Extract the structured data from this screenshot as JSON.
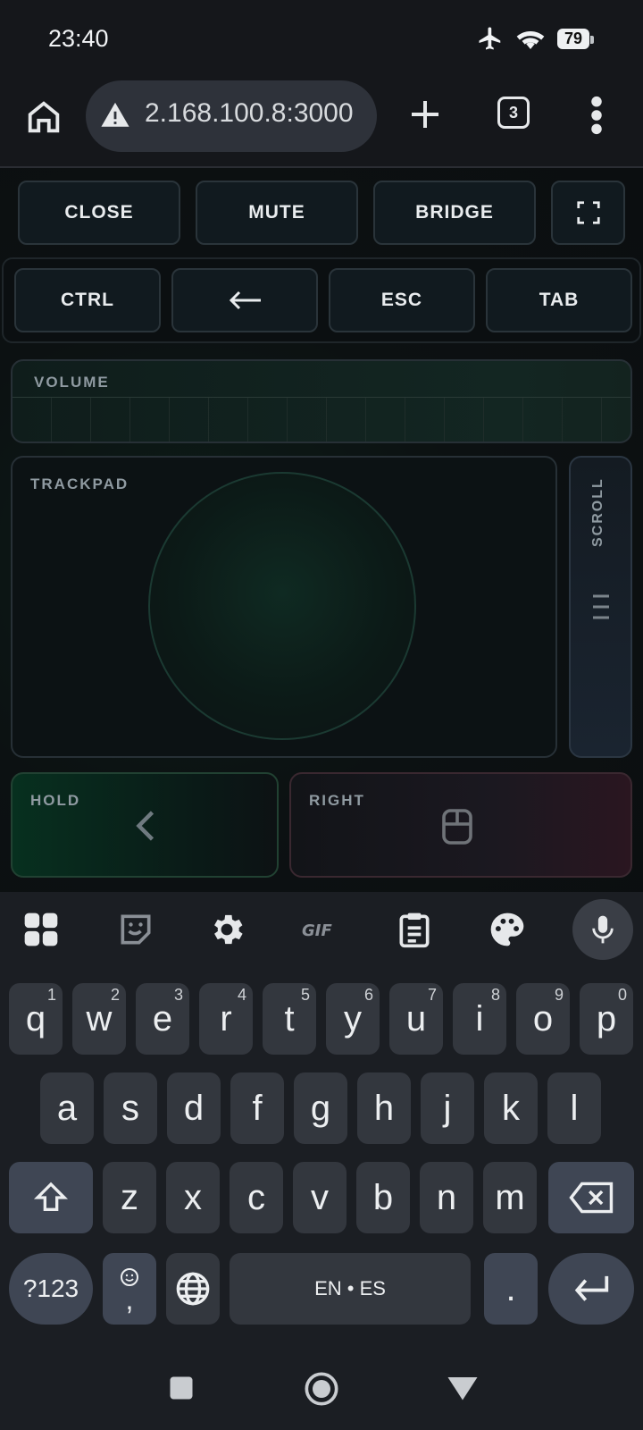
{
  "status": {
    "time": "23:40",
    "battery": "79"
  },
  "browser": {
    "url": "2.168.100.8:3000",
    "tabs_count": "3"
  },
  "controls_row1": [
    "CLOSE",
    "MUTE",
    "BRIDGE"
  ],
  "controls_row2": {
    "ctrl": "CTRL",
    "esc": "ESC",
    "tab": "TAB"
  },
  "volume": {
    "label": "VOLUME"
  },
  "trackpad": {
    "label": "TRACKPAD"
  },
  "scroll": {
    "label": "SCROLL"
  },
  "hold": {
    "label": "HOLD"
  },
  "right": {
    "label": "RIGHT"
  },
  "keyboard": {
    "row1": [
      {
        "k": "q",
        "h": "1"
      },
      {
        "k": "w",
        "h": "2"
      },
      {
        "k": "e",
        "h": "3"
      },
      {
        "k": "r",
        "h": "4"
      },
      {
        "k": "t",
        "h": "5"
      },
      {
        "k": "y",
        "h": "6"
      },
      {
        "k": "u",
        "h": "7"
      },
      {
        "k": "i",
        "h": "8"
      },
      {
        "k": "o",
        "h": "9"
      },
      {
        "k": "p",
        "h": "0"
      }
    ],
    "row2": [
      "a",
      "s",
      "d",
      "f",
      "g",
      "h",
      "j",
      "k",
      "l"
    ],
    "row3": [
      "z",
      "x",
      "c",
      "v",
      "b",
      "n",
      "m"
    ],
    "symbols_label": "?123",
    "comma_label": ",",
    "space_label": "EN • ES",
    "period_label": "."
  },
  "colors": {
    "accent_green": "#0a3a26",
    "accent_red": "#2a1620",
    "key_bg": "#33373e"
  }
}
